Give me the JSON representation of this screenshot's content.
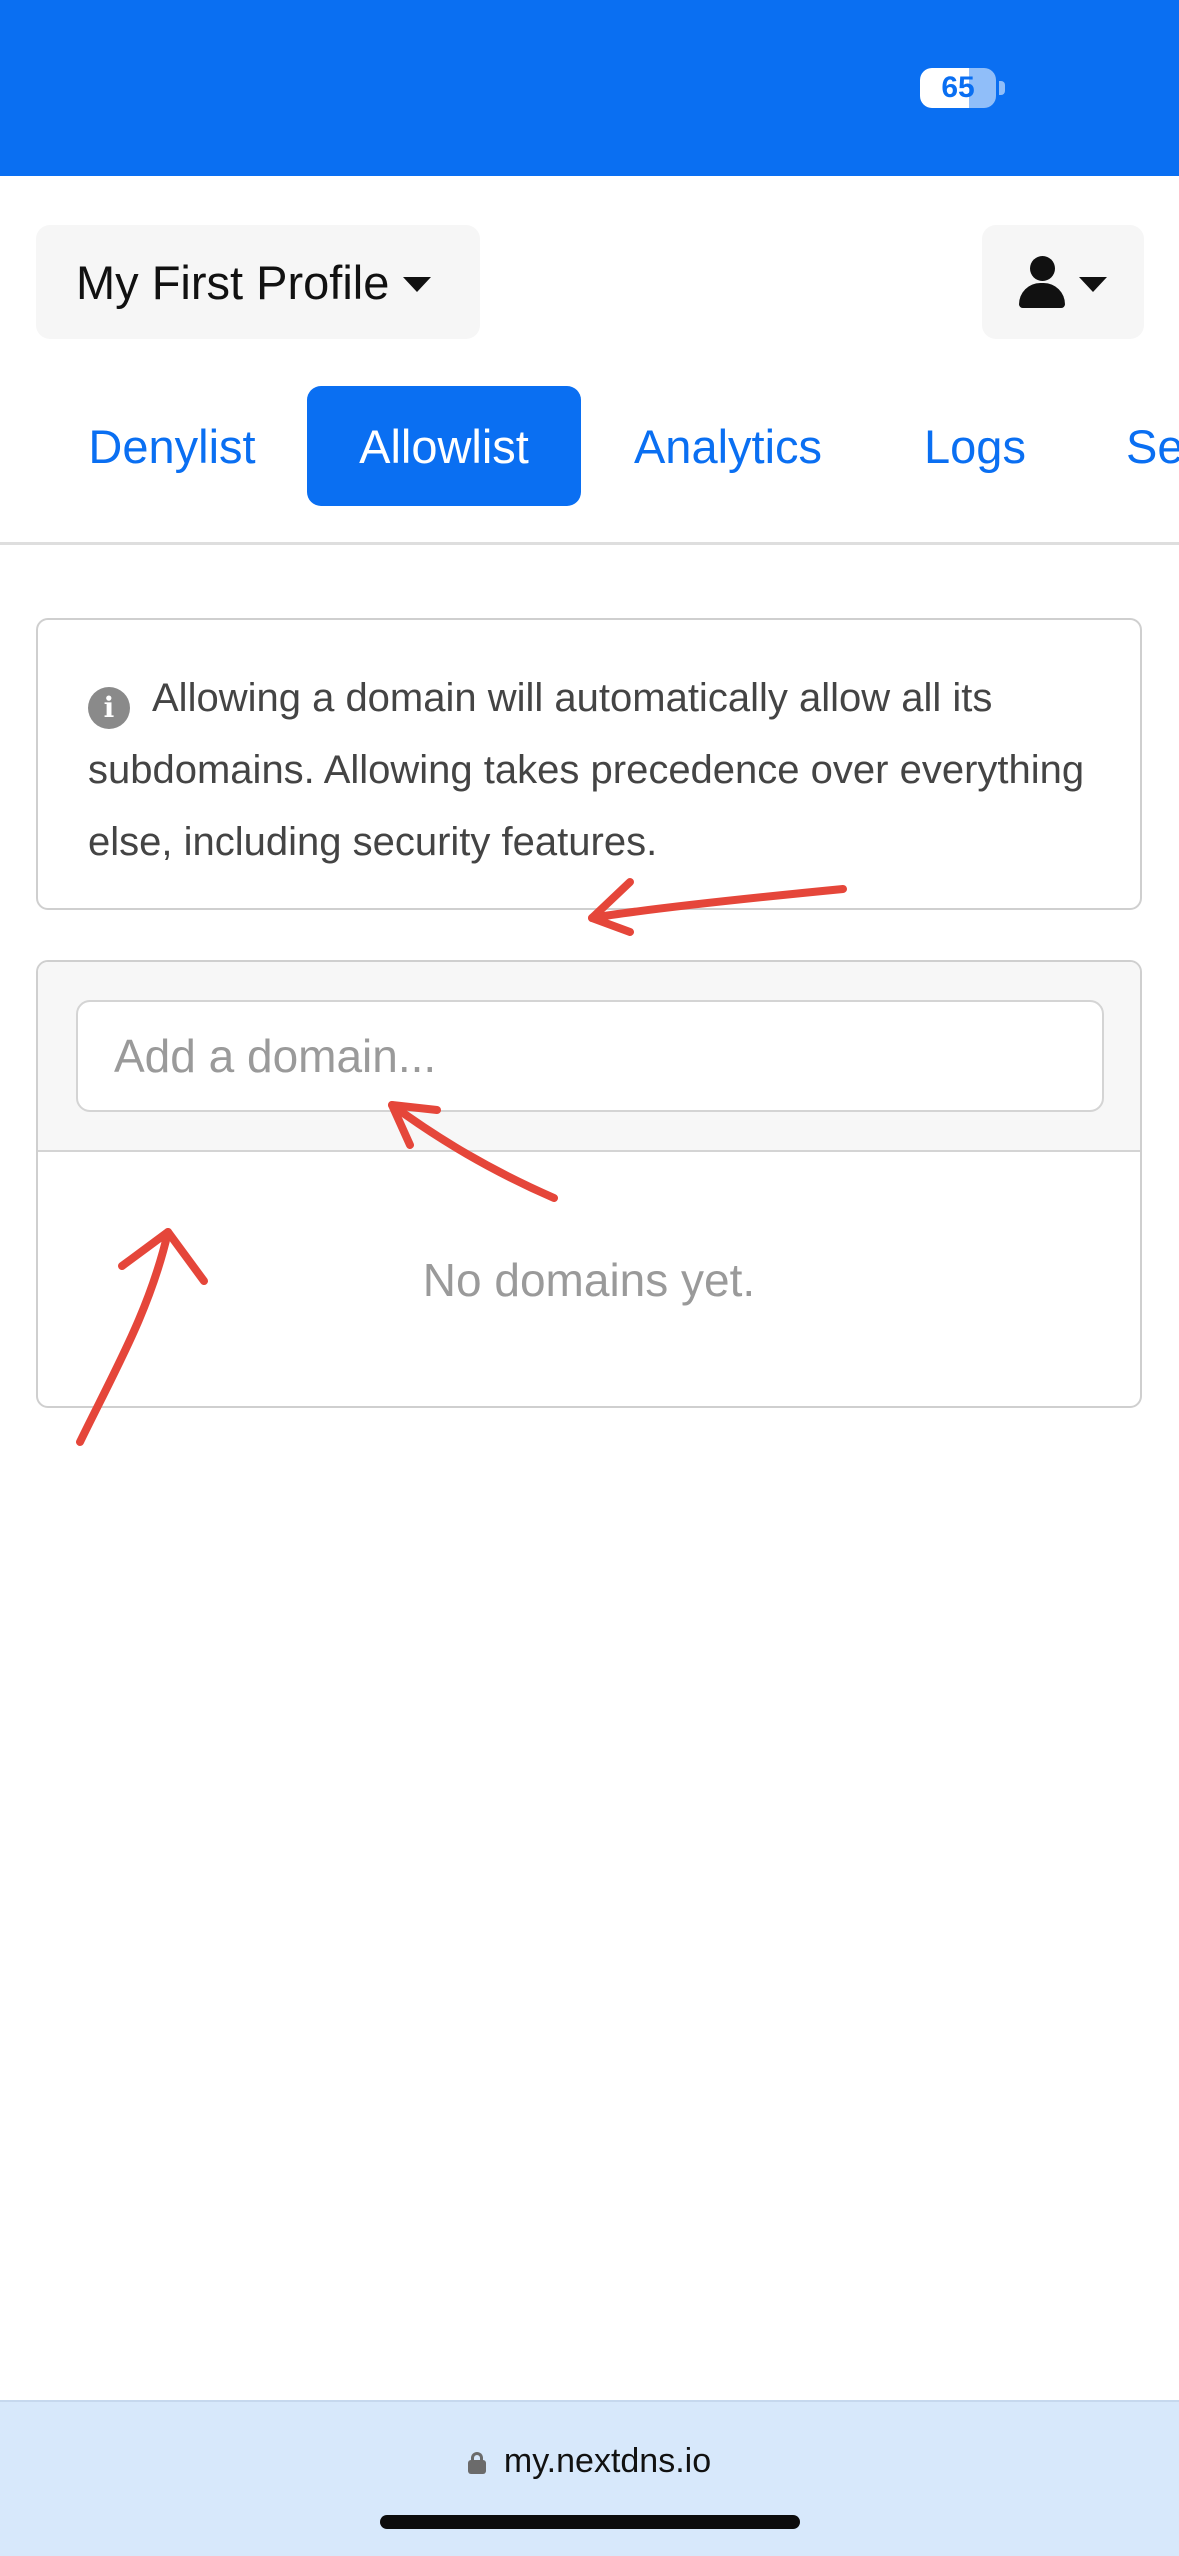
{
  "status_bar": {
    "battery_level": "65",
    "battery_fraction": 0.65
  },
  "header": {
    "profile_name": "My First Profile"
  },
  "tabs": [
    {
      "label": "Denylist",
      "active": false
    },
    {
      "label": "Allowlist",
      "active": true
    },
    {
      "label": "Analytics",
      "active": false
    },
    {
      "label": "Logs",
      "active": false
    },
    {
      "label": "Se",
      "active": false
    }
  ],
  "info": {
    "text": "Allowing a domain will automatically allow all its subdomains. Allowing takes precedence over everything else, including security features."
  },
  "domain_list": {
    "input_placeholder": "Add a domain...",
    "input_value": "",
    "empty_message": "No domains yet."
  },
  "browser": {
    "url": "my.nextdns.io"
  },
  "colors": {
    "accent": "#0a6ff2",
    "annotation": "#e5463a",
    "url_bar": "#d7e8fb"
  }
}
